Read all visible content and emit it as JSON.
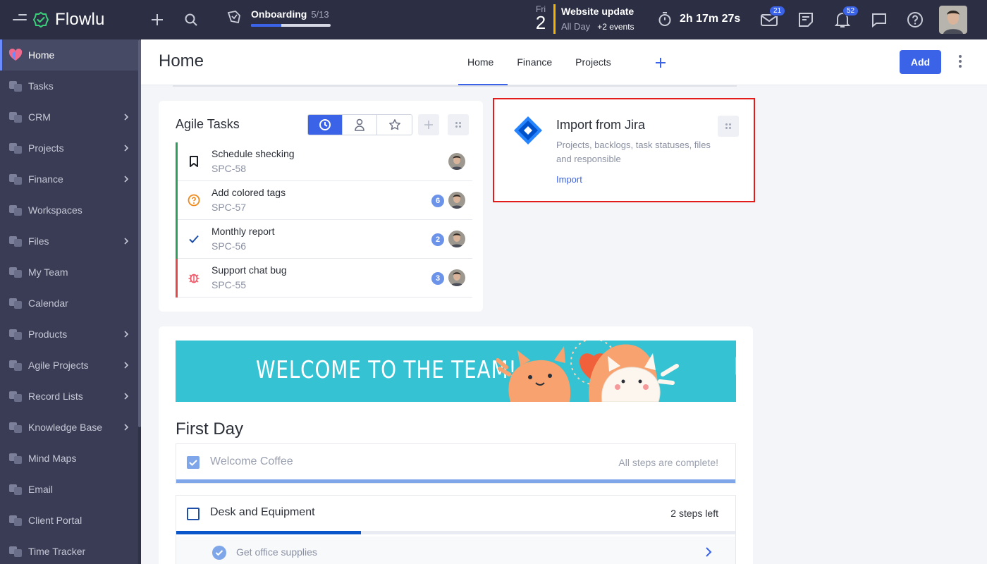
{
  "app": {
    "name": "Flowlu"
  },
  "topbar": {
    "onboarding": {
      "label": "Onboarding",
      "count": "5/13",
      "progress": 0.38
    },
    "calendar": {
      "weekday": "Fri",
      "day": "2",
      "event_title": "Website update",
      "event_time": "All Day",
      "more_events": "+2 events"
    },
    "timer": "2h 17m 27s",
    "mail_badge": "21",
    "notif_badge": "52",
    "icons": [
      "plus-icon",
      "search-icon",
      "onboarding-icon",
      "timer-icon",
      "mail-icon",
      "notes-icon",
      "bell-icon",
      "chat-icon",
      "help-icon"
    ]
  },
  "sidebar": {
    "items": [
      {
        "label": "Home",
        "active": true,
        "chevron": false
      },
      {
        "label": "Tasks",
        "chevron": false
      },
      {
        "label": "CRM",
        "chevron": true
      },
      {
        "label": "Projects",
        "chevron": true
      },
      {
        "label": "Finance",
        "chevron": true
      },
      {
        "label": "Workspaces",
        "chevron": false
      },
      {
        "label": "Files",
        "chevron": true
      },
      {
        "label": "My Team",
        "chevron": false
      },
      {
        "label": "Calendar",
        "chevron": false
      },
      {
        "label": "Products",
        "chevron": true
      },
      {
        "label": "Agile Projects",
        "chevron": true
      },
      {
        "label": "Record Lists",
        "chevron": true
      },
      {
        "label": "Knowledge Base",
        "chevron": true
      },
      {
        "label": "Mind Maps",
        "chevron": false
      },
      {
        "label": "Email",
        "chevron": false
      },
      {
        "label": "Client Portal",
        "chevron": false
      },
      {
        "label": "Time Tracker",
        "chevron": false
      }
    ]
  },
  "header": {
    "title": "Home",
    "tabs": [
      {
        "label": "Home",
        "active": true
      },
      {
        "label": "Finance"
      },
      {
        "label": "Projects"
      }
    ],
    "add_label": "Add"
  },
  "agile": {
    "title": "Agile Tasks",
    "tasks": [
      {
        "title": "Schedule shecking",
        "id": "SPC-58",
        "count": "",
        "color": "#2e9d5b",
        "icon": "bookmark-icon"
      },
      {
        "title": "Add colored tags",
        "id": "SPC-57",
        "count": "6",
        "color": "#2e9d5b",
        "icon": "question-icon"
      },
      {
        "title": "Monthly report",
        "id": "SPC-56",
        "count": "2",
        "color": "#2e9d5b",
        "icon": "check-icon"
      },
      {
        "title": "Support chat bug",
        "id": "SPC-55",
        "count": "3",
        "color": "#e24848",
        "icon": "bug-icon"
      }
    ]
  },
  "jira": {
    "title": "Import from Jira",
    "description": "Projects, backlogs, task statuses, files and responsible",
    "link": "Import"
  },
  "welcome": {
    "banner_text": "WELCOME TO THE TEAM!",
    "section_title": "First Day",
    "steps": [
      {
        "title": "Welcome Coffee",
        "status": "All steps are complete!",
        "done": true,
        "progress": 1.0
      },
      {
        "title": "Desk and Equipment",
        "status": "2 steps left",
        "done": false,
        "progress": 0.33
      }
    ],
    "substep": {
      "title": "Get office supplies",
      "done": true
    }
  },
  "colors": {
    "accent": "#3b63e8",
    "topbar": "#2c2f44",
    "sidebar": "#393c54",
    "highlight": "#e21b1b"
  }
}
